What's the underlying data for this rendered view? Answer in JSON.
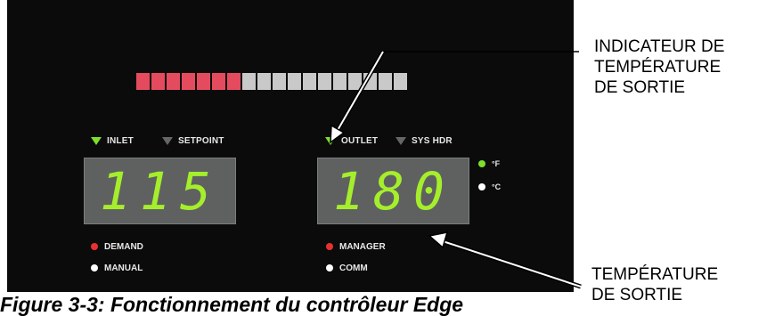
{
  "bar_graph": {
    "segments": [
      "red",
      "red",
      "red",
      "red",
      "red",
      "red",
      "red",
      "gray",
      "gray",
      "gray",
      "gray",
      "gray",
      "gray",
      "gray",
      "gray",
      "gray",
      "gray",
      "gray"
    ],
    "colors": {
      "red": "#e54b5e",
      "gray": "#c9c9c9"
    }
  },
  "left_display": {
    "indicators": [
      {
        "label": "INLET",
        "active": true
      },
      {
        "label": "SETPOINT",
        "active": false
      }
    ],
    "value": "115"
  },
  "right_display": {
    "indicators": [
      {
        "label": "OUTLET",
        "active": true
      },
      {
        "label": "SYS HDR",
        "active": false
      }
    ],
    "value": "180"
  },
  "units": [
    {
      "label": "°F",
      "color": "#7de02c"
    },
    {
      "label": "°C",
      "color": "#ffffff"
    }
  ],
  "status_leds": {
    "left": [
      {
        "label": "DEMAND",
        "color": "#e8312f"
      },
      {
        "label": "MANUAL",
        "color": "#ffffff"
      }
    ],
    "right": [
      {
        "label": "MANAGER",
        "color": "#e8312f"
      },
      {
        "label": "COMM",
        "color": "#ffffff"
      }
    ]
  },
  "callouts": {
    "outlet_indicator": [
      "INDICATEUR DE",
      "TEMPÉRATURE",
      "DE SORTIE"
    ],
    "outlet_temperature": [
      "TEMPÉRATURE",
      "DE SORTIE"
    ]
  },
  "caption": "Figure 3-3: Fonctionnement du contrôleur Edge"
}
